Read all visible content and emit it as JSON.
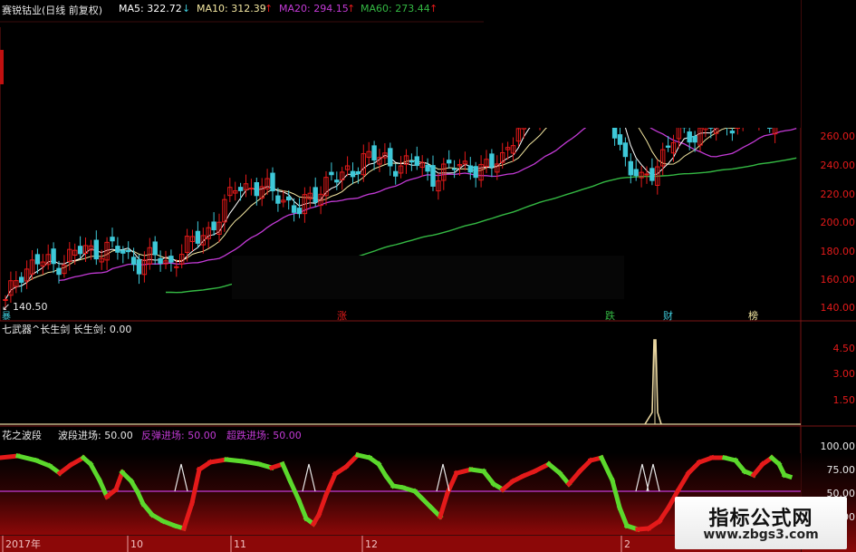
{
  "colors": {
    "up": "#e41a1a",
    "down": "#3ec8d8",
    "ma5": "#ffffff",
    "ma10": "#f3e6a0",
    "ma20": "#c33ad6",
    "ma60": "#34b843",
    "axis": "#8a1818",
    "wave_up": "#e41a1a",
    "wave_down": "#5bd82c",
    "baseline": "#c33ad6"
  },
  "header": {
    "stock": "赛锐钴业(日线 前复权)",
    "ma5_label": "MA5: 322.72",
    "ma5_arrow": "↓",
    "ma10_label": "MA10: 312.39",
    "ma10_arrow": "↑",
    "ma20_label": "MA20: 294.15",
    "ma20_arrow": "↑",
    "ma60_label": "MA60: 273.44",
    "ma60_arrow": "↑"
  },
  "main_chart": {
    "y_ticks": [
      "260.00",
      "240.00",
      "220.00",
      "200.00",
      "180.00",
      "160.00",
      "140.00"
    ],
    "low_marker": "140.50",
    "event_labels": [
      "涨",
      "跌",
      "财",
      "榜"
    ],
    "event_left_label": "暴"
  },
  "panel2": {
    "title": "七武器^长生剑  长生剑: 0.00",
    "y_ticks": [
      "4.50",
      "3.00",
      "1.50"
    ]
  },
  "panel3": {
    "title": "花之波段",
    "label1": "波段进场: 50.00",
    "label2": "反弹进场: 50.00",
    "label3": "超跌进场: 50.00",
    "y_ticks": [
      "100.00",
      "75.00",
      "50.00",
      "25.00"
    ]
  },
  "x_axis": {
    "labels": [
      "2017年",
      "10",
      "11",
      "12",
      "2"
    ]
  },
  "watermark": {
    "title": "指标公式网",
    "url": "www.zbgs3.com"
  }
}
